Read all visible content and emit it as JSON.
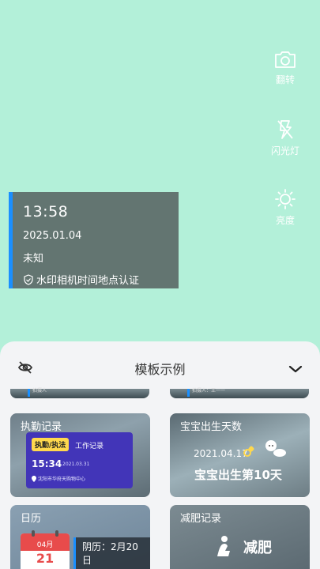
{
  "controls": {
    "flip_label": "翻转",
    "flash_label": "闪光灯",
    "brightness_label": "亮度"
  },
  "watermark": {
    "time": "13:58",
    "date": "2025.01.04",
    "location": "未知",
    "auth_text": "水印相机时间地点认证"
  },
  "sheet": {
    "title": "模板示例",
    "partial_left_text": "拍摄人",
    "partial_right_text": "拍摄人：王一一",
    "cards": [
      {
        "title": "执勤记录",
        "tag": "执勤/执法",
        "type": "工作记录",
        "time": "15:34",
        "date": "2021.03.31",
        "location": "沈阳市华府天购物中心"
      },
      {
        "title": "宝宝出生天数",
        "date": "2021.04.17",
        "days": "宝宝出生第10天"
      },
      {
        "title": "日历",
        "month": "04月",
        "day": "21",
        "lunar": "阴历：2月20日"
      },
      {
        "title": "减肥记录",
        "text": "减肥"
      }
    ]
  },
  "colors": {
    "background": "#b3f0d9",
    "accent": "#1a8fff",
    "duty_panel": "#4235b8",
    "tag": "#ffd84d"
  },
  "icons": [
    "camera-flip-icon",
    "flash-off-icon",
    "sun-icon",
    "eye-off-icon",
    "chevron-down-icon",
    "shield-icon",
    "location-pin-icon",
    "pacifier-icon",
    "baby-icon",
    "weight-loss-icon"
  ]
}
